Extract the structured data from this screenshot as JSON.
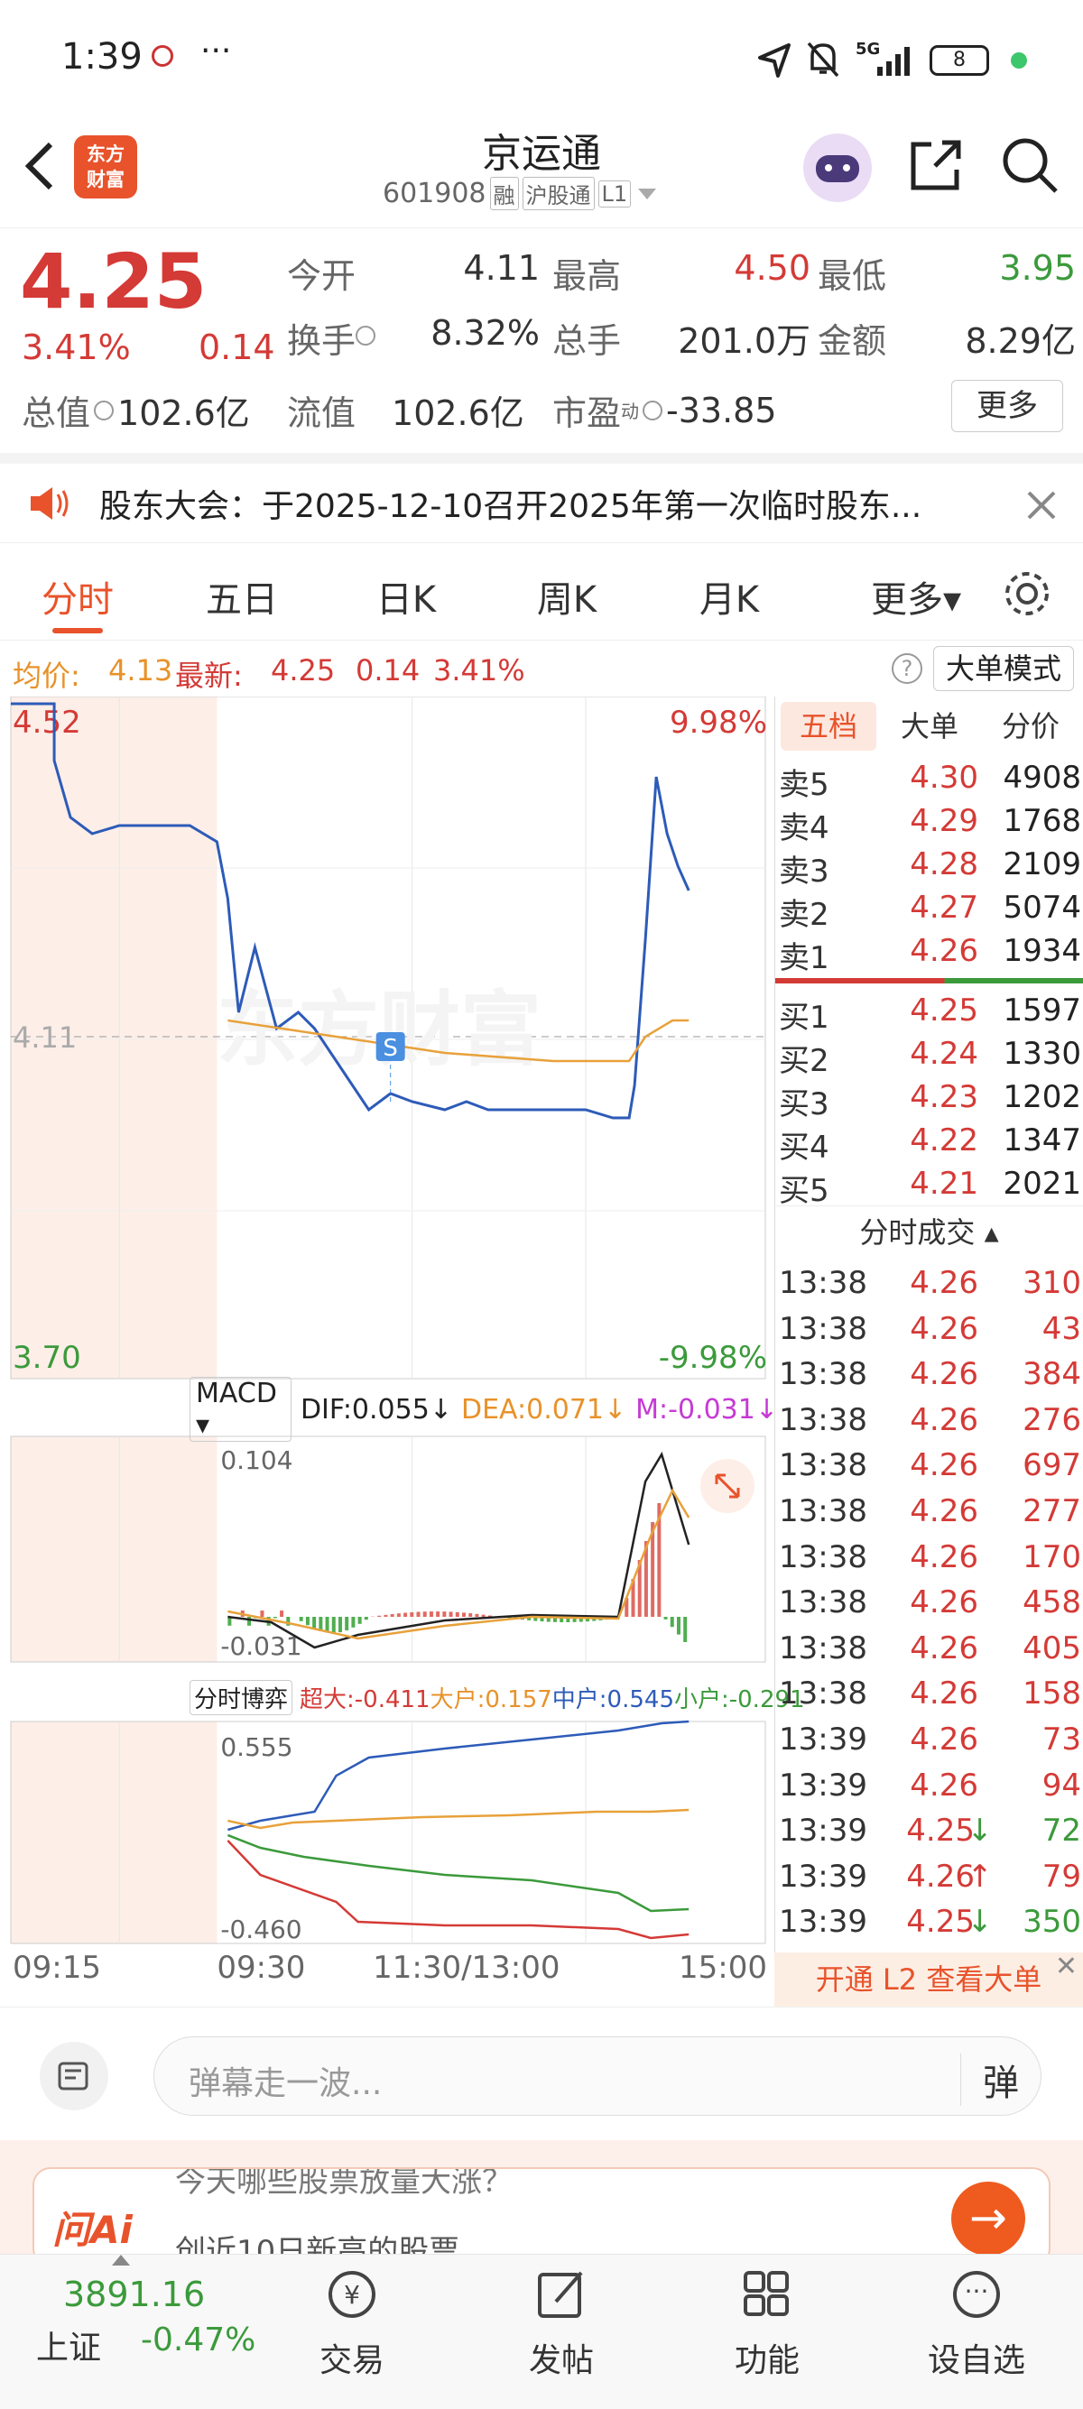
{
  "status": {
    "time": "1:39",
    "dots": "···",
    "net": "5G",
    "battery": "8"
  },
  "header": {
    "logo_line1": "东方",
    "logo_line2": "财富",
    "name": "京运通",
    "code": "601908",
    "tags": [
      "融",
      "沪股通",
      "L1"
    ]
  },
  "quote": {
    "price": "4.25",
    "pct": "3.41%",
    "chg": "0.14",
    "grid": [
      [
        "今开",
        "4.11",
        "n",
        "最高",
        "4.50",
        "r",
        "最低",
        "3.95",
        "g"
      ],
      [
        "换手",
        "8.32%",
        "n",
        "总手",
        "201.0万",
        "n",
        "金额",
        "8.29亿",
        "n"
      ]
    ],
    "zz_l": "总值",
    "zz_v": "102.6亿",
    "lz_l": "流值",
    "lz_v": "102.6亿",
    "sy_l": "市盈",
    "sy_sup": "动",
    "sy_v": "-33.85",
    "more": "更多"
  },
  "notice": {
    "text": "股东大会：于2025-12-10召开2025年第一次临时股东..."
  },
  "tabs": [
    "分时",
    "五日",
    "日K",
    "周K",
    "月K",
    "更多"
  ],
  "chartbar": {
    "avg_l": "均价:",
    "avg_v": "4.13",
    "new_l": "最新:",
    "new_v": "4.25",
    "chg": "0.14",
    "pct": "3.41%",
    "mode": "大单模式"
  },
  "chart_data": {
    "type": "line",
    "price_top": "4.52",
    "price_bottom": "3.70",
    "prev_close": "4.11",
    "pct_top": "9.98%",
    "pct_bottom": "-9.98%",
    "x_ticks": [
      "09:15",
      "09:30",
      "11:30/13:00",
      "15:00"
    ],
    "price_series": [
      [
        0,
        4.52
      ],
      [
        40,
        4.52
      ],
      [
        40,
        4.45
      ],
      [
        55,
        4.38
      ],
      [
        75,
        4.36
      ],
      [
        100,
        4.37
      ],
      [
        165,
        4.37
      ],
      [
        190,
        4.35
      ],
      [
        200,
        4.28
      ],
      [
        210,
        4.14
      ],
      [
        225,
        4.22
      ],
      [
        245,
        4.12
      ],
      [
        265,
        4.14
      ],
      [
        280,
        4.12
      ],
      [
        300,
        4.08
      ],
      [
        315,
        4.05
      ],
      [
        330,
        4.02
      ],
      [
        350,
        4.04
      ],
      [
        370,
        4.03
      ],
      [
        400,
        4.02
      ],
      [
        420,
        4.03
      ],
      [
        440,
        4.02
      ],
      [
        470,
        4.02
      ],
      [
        500,
        4.02
      ],
      [
        530,
        4.02
      ],
      [
        555,
        4.01
      ],
      [
        570,
        4.01
      ],
      [
        575,
        4.05
      ],
      [
        585,
        4.23
      ],
      [
        595,
        4.43
      ],
      [
        605,
        4.36
      ],
      [
        615,
        4.32
      ],
      [
        625,
        4.29
      ]
    ],
    "avg_series": [
      [
        200,
        4.13
      ],
      [
        300,
        4.11
      ],
      [
        400,
        4.09
      ],
      [
        500,
        4.08
      ],
      [
        570,
        4.08
      ],
      [
        585,
        4.11
      ],
      [
        610,
        4.13
      ],
      [
        625,
        4.13
      ]
    ],
    "macd": {
      "label": "MACD",
      "dif": "DIF:0.055",
      "dea": "DEA:0.071",
      "m": "M:-0.031",
      "top": "0.104",
      "bottom": "-0.031"
    },
    "boyi": {
      "label": "分时博弈",
      "cd": "超大:-0.411",
      "dd": "大户:0.157",
      "zh": "中户:0.545",
      "xh": "小户:-0.291",
      "top": "0.555",
      "bottom": "-0.460"
    }
  },
  "order_book": {
    "tabs": [
      "五档",
      "大单",
      "分价"
    ],
    "asks": [
      [
        "卖5",
        "4.30",
        "4908"
      ],
      [
        "卖4",
        "4.29",
        "1768"
      ],
      [
        "卖3",
        "4.28",
        "2109"
      ],
      [
        "卖2",
        "4.27",
        "5074"
      ],
      [
        "卖1",
        "4.26",
        "1934"
      ]
    ],
    "bids": [
      [
        "买1",
        "4.25",
        "1597"
      ],
      [
        "买2",
        "4.24",
        "1330"
      ],
      [
        "买3",
        "4.23",
        "1202"
      ],
      [
        "买4",
        "4.22",
        "1347"
      ],
      [
        "买5",
        "4.21",
        "2021"
      ]
    ]
  },
  "trades": {
    "title": "分时成交",
    "rows": [
      [
        "13:38",
        "4.26",
        "310",
        "",
        ""
      ],
      [
        "13:38",
        "4.26",
        "43",
        "",
        ""
      ],
      [
        "13:38",
        "4.26",
        "384",
        "",
        ""
      ],
      [
        "13:38",
        "4.26",
        "276",
        "",
        ""
      ],
      [
        "13:38",
        "4.26",
        "697",
        "",
        ""
      ],
      [
        "13:38",
        "4.26",
        "277",
        "",
        ""
      ],
      [
        "13:38",
        "4.26",
        "170",
        "",
        ""
      ],
      [
        "13:38",
        "4.26",
        "458",
        "",
        ""
      ],
      [
        "13:38",
        "4.26",
        "405",
        "",
        ""
      ],
      [
        "13:38",
        "4.26",
        "158",
        "",
        ""
      ],
      [
        "13:39",
        "4.26",
        "73",
        "",
        "r"
      ],
      [
        "13:39",
        "4.26",
        "94",
        "",
        "r"
      ],
      [
        "13:39",
        "4.25",
        "72",
        "↓",
        "g"
      ],
      [
        "13:39",
        "4.26",
        "79",
        "↑",
        "r"
      ],
      [
        "13:39",
        "4.25",
        "350",
        "↓",
        "g"
      ]
    ],
    "l2": "开通 L2 查看大单"
  },
  "danmu": {
    "placeholder": "弹幕走一波..."
  },
  "ai": {
    "logo": "问Ai",
    "line1": "今天哪些股票放量大涨？",
    "line2": "创近10日新高的股票"
  },
  "bottom": {
    "index_val": "3891.16",
    "index_name": "上证",
    "index_pct": "-0.47%",
    "items": [
      "交易",
      "发帖",
      "功能",
      "设自选"
    ]
  }
}
